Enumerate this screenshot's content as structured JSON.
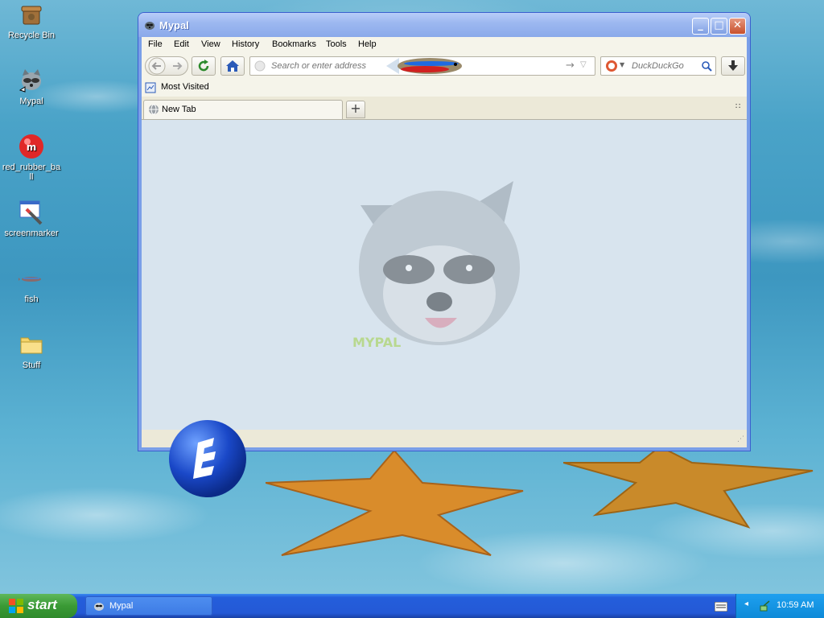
{
  "desktop": {
    "icons": [
      {
        "label": "Recycle Bin",
        "icon": "recycle-bin-icon"
      },
      {
        "label": "Mypal",
        "icon": "mypal-raccoon-icon"
      },
      {
        "label": "red_rubber_ball",
        "icon": "red-rubber-ball-icon"
      },
      {
        "label": "screenmarker",
        "icon": "screenmarker-icon"
      },
      {
        "label": "fish",
        "icon": "fish-icon"
      },
      {
        "label": "Stuff",
        "icon": "folder-icon"
      }
    ]
  },
  "window": {
    "title": "Mypal",
    "controls": {
      "minimize": "_",
      "maximize": "□",
      "close": "✕"
    },
    "menu": [
      "File",
      "Edit",
      "View",
      "History",
      "Bookmarks",
      "Tools",
      "Help"
    ],
    "url_placeholder": "Search or enter address",
    "search_engine": "DuckDuckGo",
    "bookmarks": [
      {
        "label": "Most Visited"
      }
    ],
    "tabs": [
      {
        "label": "New Tab"
      }
    ],
    "new_tab_symbol": "+"
  },
  "taskbar": {
    "start_label": "start",
    "items": [
      {
        "label": "Mypal"
      }
    ],
    "clock": "10:59 AM"
  },
  "colors": {
    "taskbar_blue": "#245edb",
    "start_green": "#3a9a35",
    "titlebar": "#9db8f0",
    "content_bg": "#d8e4ee"
  }
}
